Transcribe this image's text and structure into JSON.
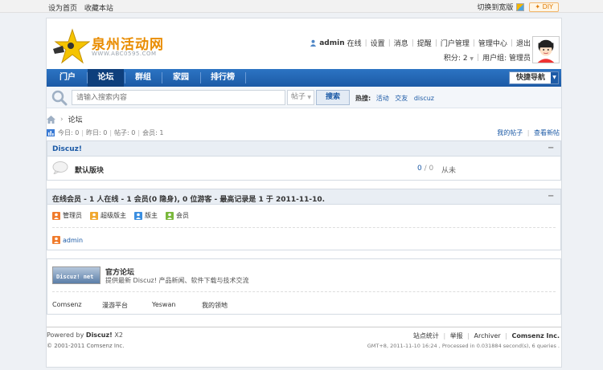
{
  "topbar": {
    "set_home": "设为首页",
    "bookmark": "收藏本站",
    "switch_wide": "切换到宽版",
    "diy": "DIY"
  },
  "logo": {
    "title": "泉州活动网",
    "url": "WWW.ABC0595.COM"
  },
  "user": {
    "name": "admin",
    "status": "在线",
    "links": [
      "设置",
      "消息",
      "提醒",
      "门户管理",
      "管理中心",
      "退出"
    ],
    "points_label": "积分: 2",
    "group_label": "用户组: 管理员"
  },
  "nav": {
    "items": [
      "门户",
      "论坛",
      "群组",
      "家园",
      "排行榜"
    ],
    "active": "论坛",
    "quick_nav": "快捷导航"
  },
  "search": {
    "placeholder": "请输入搜索内容",
    "type": "帖子",
    "button": "搜索",
    "hot_label": "热搜:",
    "hot_links": [
      "活动",
      "交友",
      "discuz"
    ]
  },
  "breadcrumb": {
    "current": "论坛"
  },
  "stats": {
    "today": "今日: 0",
    "yesterday": "昨日: 0",
    "posts": "帖子: 0",
    "members": "会员: 1",
    "my_posts": "我的帖子",
    "new_posts": "查看新帖"
  },
  "forum_group": {
    "title": "Discuz!",
    "forum_name": "默认版块",
    "threads": "0",
    "posts": "0",
    "last_post": "从未"
  },
  "online": {
    "title": "在线会员 - 1 人在线 - 1 会员(0 隐身), 0 位游客 - 最高记录是 1 于 2011-11-10.",
    "legend": [
      "管理员",
      "超级版主",
      "版主",
      "会员"
    ],
    "users": [
      "admin"
    ],
    "colors": {
      "admin": "#f07b2c",
      "super_mod": "#f0a830",
      "mod": "#3a8ee0",
      "member": "#7ab83c"
    }
  },
  "links_panel": {
    "logo_text": "Discuz! net",
    "title": "官方论坛",
    "desc": "提供最新 Discuz! 产品新闻、软件下载与技术交流",
    "text_links": [
      "Comsenz",
      "漫游平台",
      "Yeswan",
      "我的领地"
    ]
  },
  "footer": {
    "powered_prefix": "Powered by",
    "powered_brand": "Discuz!",
    "powered_version": "X2",
    "copyright": "© 2001-2011 Comsenz Inc.",
    "links": [
      "站点统计",
      "举报",
      "Archiver"
    ],
    "company": "Comsenz Inc.",
    "processed": "GMT+8, 2011-11-10 16:24 , Processed in 0.031884 second(s), 6 queries ."
  },
  "colors": {
    "nav_bg": "#1c5aa6",
    "nav_active": "#0e3f7c",
    "link": "#1c5aa6",
    "logo_orange": "#e98c00"
  }
}
